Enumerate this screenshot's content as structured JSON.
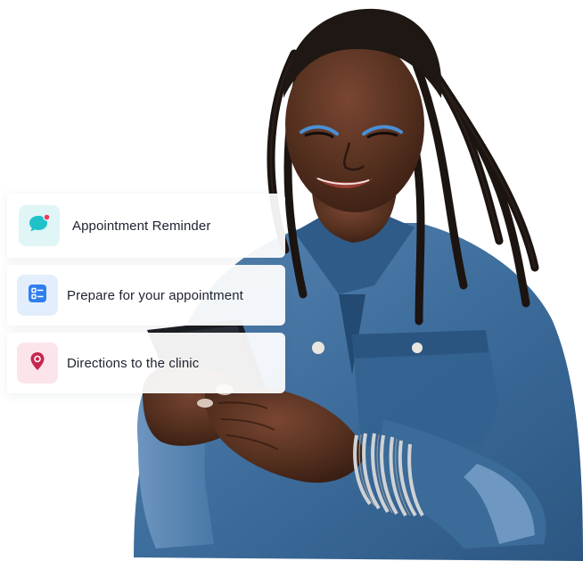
{
  "cards": [
    {
      "label": "Appointment Reminder",
      "icon": "chat-bubble-notification-icon",
      "tile_color": "#dff5f6",
      "icon_color": "#1ec2c8",
      "dot_color": "#ef3b5c"
    },
    {
      "label": "Prepare for your appointment",
      "icon": "checklist-icon",
      "tile_color": "#e3eefc",
      "icon_color": "#2f7ef0"
    },
    {
      "label": "Directions to the clinic",
      "icon": "location-pin-icon",
      "tile_color": "#fce5ea",
      "icon_color": "#c8264f"
    }
  ],
  "colors": {
    "background": "#ffffff",
    "denim": "#3b6b98",
    "skin": "#4a2a1e"
  }
}
